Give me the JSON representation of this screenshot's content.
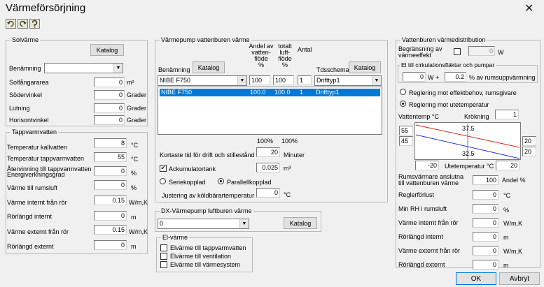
{
  "window": {
    "title": "Värmeförsörjning",
    "close": "✕"
  },
  "toolbar": {
    "icons": [
      "undo-icon",
      "redo-icon",
      "help-icon"
    ]
  },
  "solar": {
    "title": "Solvärme",
    "catalog": "Katalog",
    "name_label": "Benämning",
    "name_value": "",
    "rows": [
      {
        "label": "Solfångararea",
        "value": "0",
        "unit": "m²"
      },
      {
        "label": "Södervinkel",
        "value": "0",
        "unit": "Grader"
      },
      {
        "label": "Lutning",
        "value": "0",
        "unit": "Grader"
      },
      {
        "label": "Horisontvinkel",
        "value": "0",
        "unit": "Grader"
      }
    ]
  },
  "tapwater": {
    "title": "Tappvarmvatten",
    "rows": [
      {
        "label": "Temperatur kallvatten",
        "value": "8",
        "unit": "°C"
      },
      {
        "label": "Temperatur tappvarmvatten",
        "value": "55",
        "unit": "°C"
      },
      {
        "label": "Återvinning till tappvarmvatten",
        "label2": "Energiverkningsgrad",
        "value": "0",
        "unit": "%"
      },
      {
        "label": "Värme till rumsluft",
        "value": "0",
        "unit": "%"
      },
      {
        "label": "Värme internt från rör",
        "value": "0.15",
        "unit": "W/m,K"
      },
      {
        "label": "Rörlängd internt",
        "value": "0",
        "unit": "m"
      },
      {
        "label": "Värme externt från rör",
        "value": "0.15",
        "unit": "W/m,K"
      },
      {
        "label": "Rörlängd externt",
        "value": "0",
        "unit": "m"
      }
    ]
  },
  "heatpump": {
    "title": "Värmepump vattenburen värme",
    "col_name": "Benämning",
    "catalog": "Katalog",
    "col_water": "Andel av vatten-flöde %",
    "col_water_lines": [
      "Andel av",
      "vatten-",
      "flöde",
      "%"
    ],
    "col_total_lines": [
      "totalt",
      "luft-",
      "flöde",
      "%"
    ],
    "col_count": "Antal",
    "col_schedule": "Tdsschema",
    "catalog2": "Katalog",
    "name_value": "NIBE F750",
    "water_value": "100",
    "air_value": "100",
    "count_value": "1",
    "schedule_value": "Drifttyp1",
    "list": [
      {
        "name": "NIBE F750",
        "water": "100.0",
        "air": "100.0",
        "count": "1",
        "schedule": "Drifttyp1"
      }
    ],
    "sum_water": "100%",
    "sum_air": "100%",
    "short_time_label": "Kortaste tid för drift och stillestånd",
    "short_time_value": "20",
    "short_time_unit": "Minuter",
    "tank_label": "Ackumulatortank",
    "tank_checked": true,
    "tank_value": "0.025",
    "tank_unit": "m³",
    "serial": "Seriekopplad",
    "parallel": "Parallellkopplad",
    "adjust_label": "Justering av köldbärartemperatur",
    "adjust_value": "0",
    "adjust_unit": "°C"
  },
  "dx": {
    "title": "DX-Värmepump luftburen värme",
    "select_value": "0",
    "catalog": "Katalog"
  },
  "electric": {
    "title": "El-värme",
    "items": [
      "Elvärme till tappvarmvatten",
      "Elvärme till ventilation",
      "Elvärme till värmesystem"
    ]
  },
  "distribution": {
    "title": "Vattenburen värmedistribution",
    "limit_label": "Begränsning av värmeeffekt",
    "limit_lines": [
      "Begränsning av",
      "värmeeffekt"
    ],
    "limit_value": "0",
    "limit_unit": "W",
    "circ_title": "El till cirkulationsfläktar och pumpar",
    "circ_w_value": "0",
    "circ_w_unit": "W +",
    "circ_pct_value": "0.2",
    "circ_pct_unit": "% av rumsuppvärmning",
    "reg1": "Reglering mot effektbehov, rumsgivare",
    "reg2": "Reglering mot utetemperatur",
    "water_temp_label": "Vattentemp °C",
    "kink_label": "Krökning",
    "kink_value": "1",
    "chart_left_top": "55",
    "chart_left_bottom": "45",
    "chart_right_top": "20",
    "chart_right_bottom": "20",
    "chart_label_top": "37.5",
    "chart_label_bottom": "32.5",
    "out_left": "-20",
    "out_label": "Utetemperatur °C",
    "out_right": "20",
    "radiator_label_lines": [
      "Rumsvärmare anslutna",
      "till vattenburen värme"
    ],
    "radiator_value": "100",
    "radiator_unit": "Andel %",
    "rows": [
      {
        "label": "Reglerförlust",
        "value": "0",
        "unit": "°C"
      },
      {
        "label": "Min RH i rumsluft",
        "value": "0",
        "unit": "%"
      },
      {
        "label": "Värme internt från rör",
        "value": "0",
        "unit": "W/m,K"
      },
      {
        "label": "Rörlängd internt",
        "value": "0",
        "unit": "m"
      },
      {
        "label": "Värme externt från rör",
        "value": "0",
        "unit": "W/m,K"
      },
      {
        "label": "Rörlängd externt",
        "value": "0",
        "unit": "m"
      }
    ]
  },
  "buttons": {
    "ok": "OK",
    "cancel": "Avbryt"
  },
  "colors": {
    "selection": "#0078d7",
    "supply_line": "#e0201c",
    "return_line": "#2030d0"
  }
}
